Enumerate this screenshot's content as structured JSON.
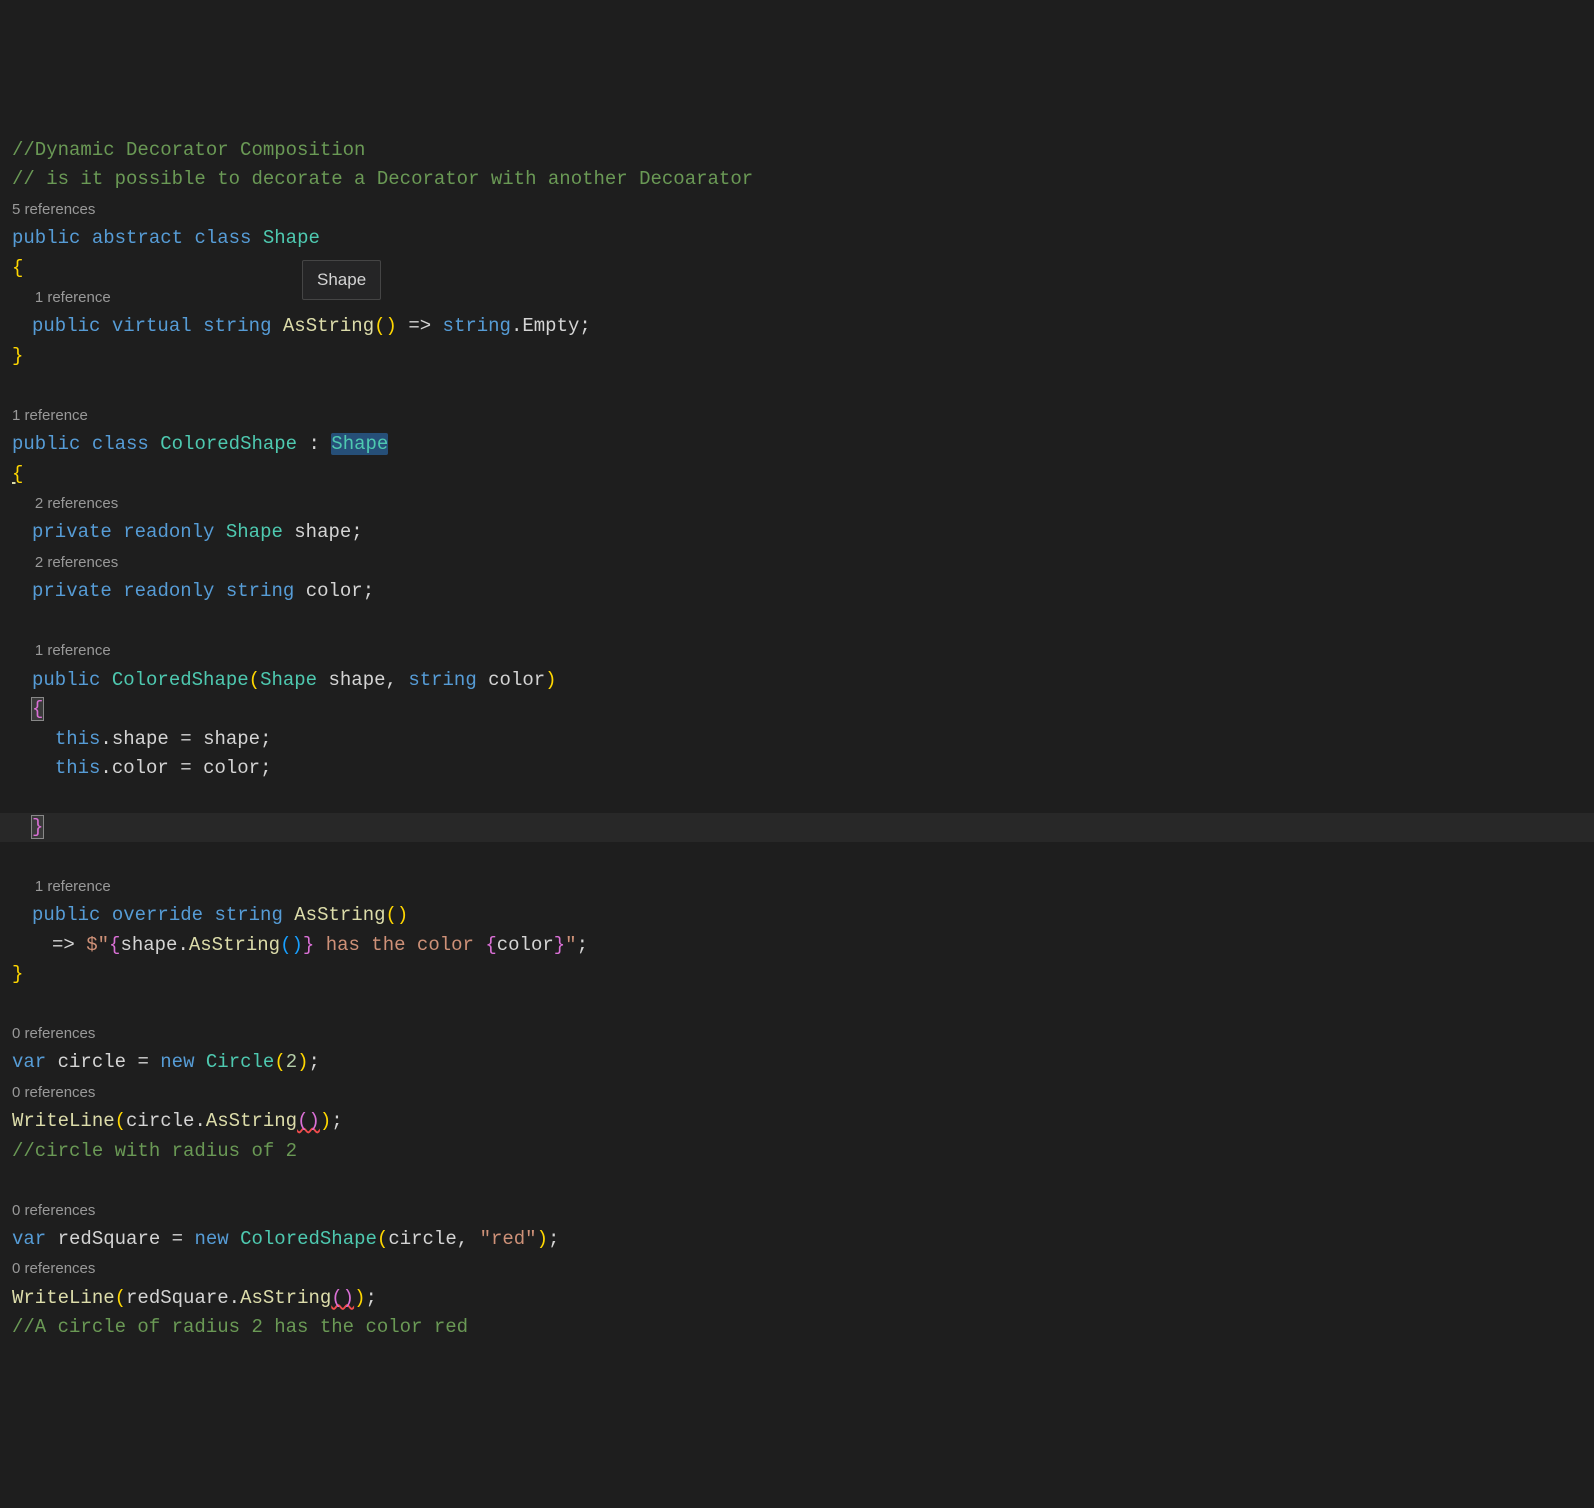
{
  "tooltip": "Shape",
  "codelens": {
    "ref5": "5 references",
    "ref1a": "1 reference",
    "ref1b": "1 reference",
    "ref2a": "2 references",
    "ref2b": "2 references",
    "ref1c": "1 reference",
    "ref1d": "1 reference",
    "ref0a": "0 references",
    "ref0b": "0 references",
    "ref0c": "0 references",
    "ref0d": "0 references"
  },
  "tok": {
    "c1": "//Dynamic Decorator Composition",
    "c2": "// is it possible to decorate a Decorator with another Decoarator",
    "public": "public",
    "abstract": "abstract",
    "class": "class",
    "Shape": "Shape",
    "virtual": "virtual",
    "string": "string",
    "AsString": "AsString",
    "arrow": "=>",
    "Empty": "Empty",
    "ColoredShape": "ColoredShape",
    "private": "private",
    "readonly": "readonly",
    "shape": "shape",
    "color": "color",
    "this": "this",
    "override": "override",
    "interp_open": "$\"",
    "interp_mid1": " has the color ",
    "interp_close": "\"",
    "var": "var",
    "circle": "circle",
    "new": "new",
    "Circle": "Circle",
    "two": "2",
    "WriteLine": "WriteLine",
    "c3": "//circle with radius of 2",
    "redSquare": "redSquare",
    "red": "\"red\"",
    "c4": "//A circle of radius 2 has the color red"
  }
}
